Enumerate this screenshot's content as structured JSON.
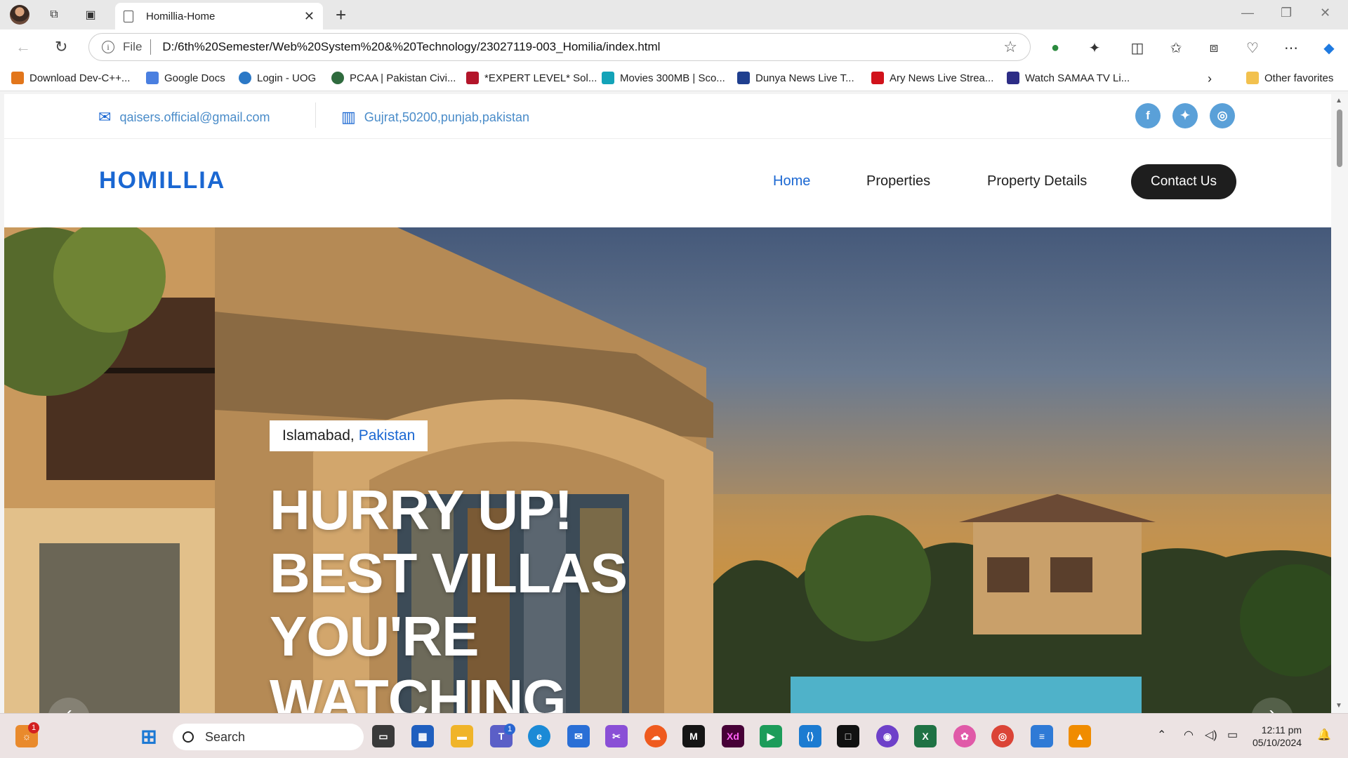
{
  "browser": {
    "tab_title": "Homillia-Home",
    "protocol_label": "File",
    "url": "D:/6th%20Semester/Web%20System%20&%20Technology/23027119-003_Homilia/index.html",
    "bookmarks": [
      {
        "label": "Download Dev-C++...",
        "color": "#e2761b"
      },
      {
        "label": "Google Docs",
        "color": "#4a7fe0"
      },
      {
        "label": "Login - UOG",
        "color": "#2b78c6"
      },
      {
        "label": "PCAA | Pakistan Civi...",
        "color": "#2f6b3e"
      },
      {
        "label": "*EXPERT LEVEL* Sol...",
        "color": "#b3152a"
      },
      {
        "label": "Movies 300MB | Sco...",
        "color": "#13a3b8"
      },
      {
        "label": "Dunya News Live T...",
        "color": "#1f3f8f"
      },
      {
        "label": "Ary News Live Strea...",
        "color": "#d1121b"
      },
      {
        "label": "Watch SAMAA TV Li...",
        "color": "#2d2d86"
      }
    ],
    "other_favorites": "Other favorites"
  },
  "site": {
    "email": "qaisers.official@gmail.com",
    "address": "Gujrat,50200,punjab,pakistan",
    "logo": "HOMILLIA",
    "nav": {
      "home": "Home",
      "properties": "Properties",
      "property_details": "Property Details",
      "contact": "Contact Us"
    },
    "hero": {
      "city": "Islamabad,",
      "country": "Pakistan",
      "line1": "HURRY UP!",
      "line2": "BEST VILLAS",
      "line3": "YOU'RE",
      "line4": "WATCHING"
    },
    "accent_color": "#1a67d2"
  },
  "taskbar": {
    "search_placeholder": "Search",
    "time": "12:11 pm",
    "date": "05/10/2024",
    "notification_count": "1",
    "teams_badge": "1"
  }
}
